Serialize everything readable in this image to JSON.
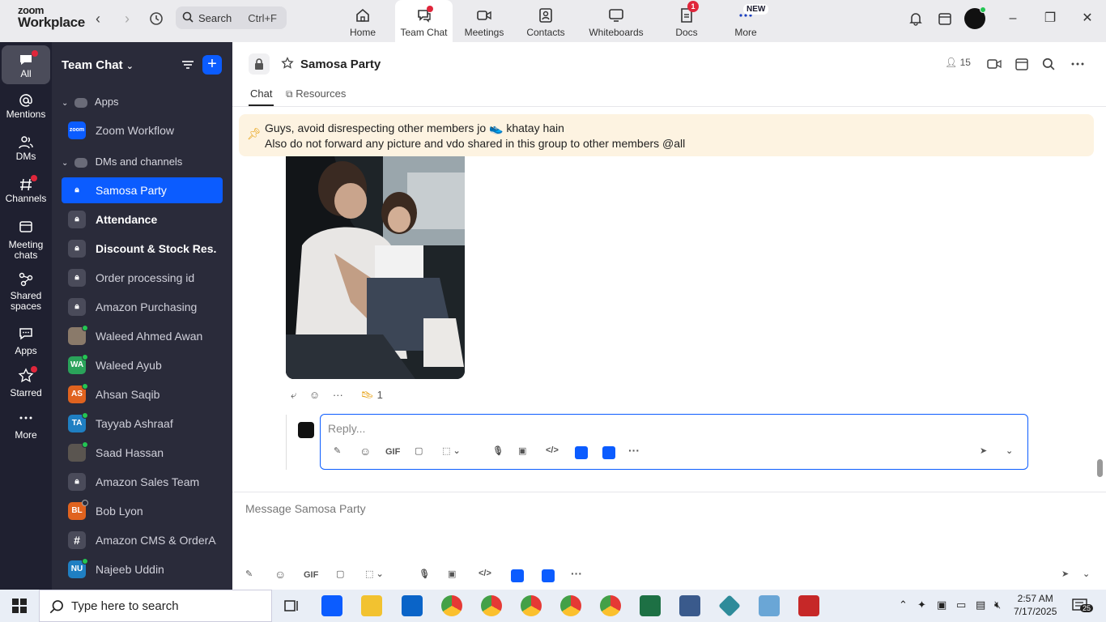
{
  "app": {
    "logo_line1": "zoom",
    "logo_line2": "Workplace",
    "search_label": "Search",
    "search_shortcut": "Ctrl+F"
  },
  "top_tabs": [
    {
      "label": "Home",
      "icon": "home-icon"
    },
    {
      "label": "Team Chat",
      "icon": "chat-icon"
    },
    {
      "label": "Meetings",
      "icon": "video-camera-icon"
    },
    {
      "label": "Contacts",
      "icon": "contacts-icon"
    },
    {
      "label": "Whiteboards",
      "icon": "whiteboard-icon"
    },
    {
      "label": "Docs",
      "icon": "docs-icon"
    },
    {
      "label": "More",
      "icon": "more-icon"
    }
  ],
  "badges": {
    "docs": "1",
    "more": "NEW"
  },
  "rail": [
    {
      "label": "All",
      "icon": "chat-bubble-icon"
    },
    {
      "label": "Mentions",
      "icon": "at-icon"
    },
    {
      "label": "DMs",
      "icon": "people-icon"
    },
    {
      "label": "Channels",
      "icon": "hash-icon"
    },
    {
      "label": "Meeting chats",
      "icon": "calendar-chat-icon"
    },
    {
      "label": "Shared spaces",
      "icon": "shared-spaces-icon"
    },
    {
      "label": "Apps",
      "icon": "apps-icon"
    },
    {
      "label": "Starred",
      "icon": "star-icon"
    },
    {
      "label": "More",
      "icon": "ellipsis-icon"
    }
  ],
  "sidebar": {
    "title": "Team Chat",
    "section_apps": "Apps",
    "app_item": "Zoom Workflow",
    "app_logo_text": "zoom",
    "section_dms": "DMs and channels",
    "items": [
      {
        "label": "Samosa Party",
        "type": "channel"
      },
      {
        "label": "Attendance",
        "type": "channel"
      },
      {
        "label": "Discount & Stock Res...",
        "type": "channel"
      },
      {
        "label": "Order processing id",
        "type": "channel"
      },
      {
        "label": "Amazon Purchasing",
        "type": "channel"
      },
      {
        "label": "Waleed Ahmed Awan",
        "type": "dm-photo"
      },
      {
        "label": "Waleed Ayub",
        "type": "dm",
        "initials": "WA"
      },
      {
        "label": "Ahsan Saqib",
        "type": "dm",
        "initials": "AS"
      },
      {
        "label": "Tayyab Ashraaf",
        "type": "dm",
        "initials": "TA"
      },
      {
        "label": "Saad Hassan",
        "type": "dm-photo"
      },
      {
        "label": "Amazon Sales Team",
        "type": "channel"
      },
      {
        "label": "Bob Lyon",
        "type": "dm",
        "initials": "BL"
      },
      {
        "label": "Amazon CMS & OrderA...",
        "type": "hash"
      },
      {
        "label": "Najeeb Uddin",
        "type": "dm",
        "initials": "NU"
      }
    ]
  },
  "channel": {
    "title": "Samosa Party",
    "member_count": "15",
    "tab_chat": "Chat",
    "tab_resources": "Resources",
    "pinned_line1": "Guys, avoid disrespecting other members jo 👟 khatay hain",
    "pinned_line2": "Also do not forward any picture and vdo shared in this group to other members @all",
    "reaction_count": "1",
    "reply_placeholder": "Reply...",
    "composer_placeholder": "Message Samosa Party",
    "gif_label": "GIF"
  },
  "taskbar": {
    "search_placeholder": "Type here to search",
    "time": "2:57 AM",
    "date": "7/17/2025",
    "notification_count": "25"
  },
  "colors": {
    "accent": "#0b5cff",
    "rail_bg": "#1f2030",
    "sidebar_bg": "#2a2b3a",
    "pinned_bg": "#fdf3e1",
    "notification_red": "#e0263b"
  }
}
